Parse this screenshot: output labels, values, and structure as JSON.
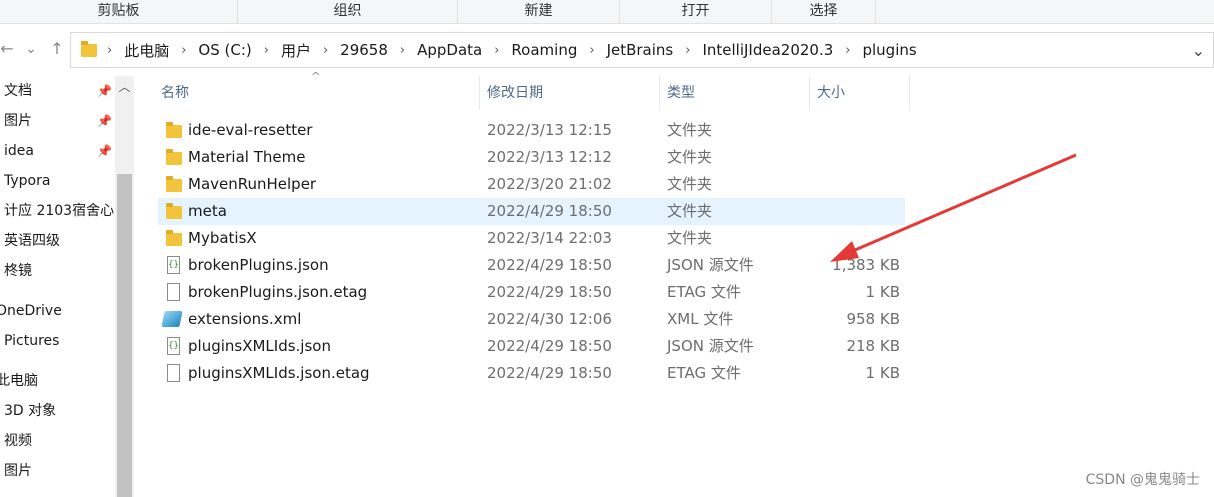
{
  "ribbon": {
    "groups": [
      "剪贴板",
      "组织",
      "新建",
      "打开",
      "选择"
    ]
  },
  "nav_buttons": {
    "back_icon": "←",
    "dropdown_icon": "⌄",
    "up_icon": "↑"
  },
  "address": {
    "crumbs": [
      "此电脑",
      "OS (C:)",
      "用户",
      "29658",
      "AppData",
      "Roaming",
      "JetBrains",
      "IntelliJIdea2020.3",
      "plugins"
    ],
    "dropdown_icon": "⌄"
  },
  "navpane": {
    "items": [
      "文档",
      "图片",
      "idea",
      "Typora",
      "计应 2103宿舍心",
      "英语四级",
      "柊镜",
      "OneDrive",
      "Pictures",
      "此电脑",
      "3D 对象",
      "视频",
      "图片"
    ],
    "pin_icon": "📌"
  },
  "columns": {
    "name": "名称",
    "date": "修改日期",
    "type": "类型",
    "size": "大小",
    "sort_icon": "^"
  },
  "files": [
    {
      "name": "ide-eval-resetter",
      "date": "2022/3/13 12:15",
      "type": "文件夹",
      "size": "",
      "icon": "folder-icon"
    },
    {
      "name": "Material Theme",
      "date": "2022/3/13 12:12",
      "type": "文件夹",
      "size": "",
      "icon": "folder-icon"
    },
    {
      "name": "MavenRunHelper",
      "date": "2022/3/20 21:02",
      "type": "文件夹",
      "size": "",
      "icon": "folder-icon"
    },
    {
      "name": "meta",
      "date": "2022/4/29 18:50",
      "type": "文件夹",
      "size": "",
      "icon": "folder-icon",
      "selected": true
    },
    {
      "name": "MybatisX",
      "date": "2022/3/14 22:03",
      "type": "文件夹",
      "size": "",
      "icon": "folder-icon"
    },
    {
      "name": "brokenPlugins.json",
      "date": "2022/4/29 18:50",
      "type": "JSON 源文件",
      "size": "1,383 KB",
      "icon": "json-file-icon"
    },
    {
      "name": "brokenPlugins.json.etag",
      "date": "2022/4/29 18:50",
      "type": "ETAG 文件",
      "size": "1 KB",
      "icon": "file-icon"
    },
    {
      "name": "extensions.xml",
      "date": "2022/4/30 12:06",
      "type": "XML 文件",
      "size": "958 KB",
      "icon": "xml-file-icon"
    },
    {
      "name": "pluginsXMLIds.json",
      "date": "2022/4/29 18:50",
      "type": "JSON 源文件",
      "size": "218 KB",
      "icon": "json-file-icon"
    },
    {
      "name": "pluginsXMLIds.json.etag",
      "date": "2022/4/29 18:50",
      "type": "ETAG 文件",
      "size": "1 KB",
      "icon": "file-icon"
    }
  ],
  "watermark": "CSDN @鬼鬼骑士",
  "colors": {
    "selection": "#e5f3ff",
    "header_text": "#4d6a88",
    "annotation_arrow": "#e53935"
  }
}
